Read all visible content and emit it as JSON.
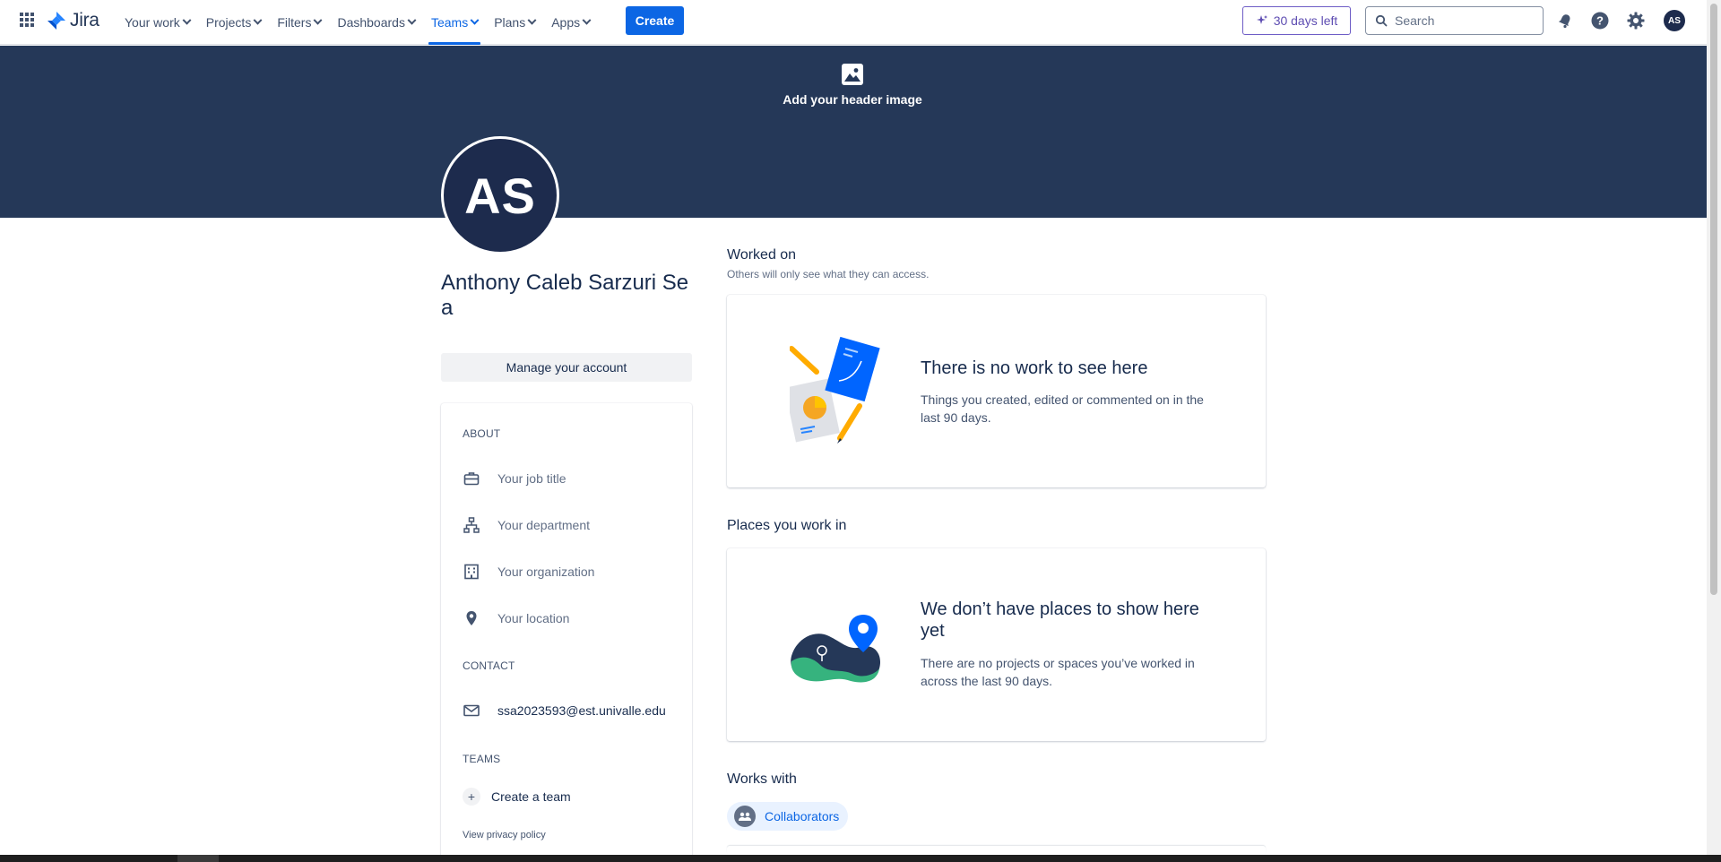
{
  "topnav": {
    "logo_text": "Jira",
    "items": [
      {
        "label": "Your work"
      },
      {
        "label": "Projects"
      },
      {
        "label": "Filters"
      },
      {
        "label": "Dashboards"
      },
      {
        "label": "Teams",
        "active": true
      },
      {
        "label": "Plans"
      },
      {
        "label": "Apps"
      }
    ],
    "create_label": "Create",
    "trial_label": "30 days left",
    "search_placeholder": "Search",
    "avatar_initials": "AS",
    "icons": [
      "apps-grid-icon",
      "jira-logo-icon",
      "sparkle-icon",
      "search-icon",
      "notifications-icon",
      "help-icon",
      "settings-icon"
    ]
  },
  "header": {
    "add_image_label": "Add your header image"
  },
  "profile": {
    "initials": "AS",
    "name": "Anthony Caleb Sarzuri Sea",
    "manage_label": "Manage your account"
  },
  "about": {
    "heading": "ABOUT",
    "job_title": "Your job title",
    "department": "Your department",
    "organization": "Your organization",
    "location": "Your location",
    "contact_heading": "CONTACT",
    "email": "ssa2023593@est.univalle.edu",
    "teams_heading": "TEAMS",
    "create_team": "Create a team",
    "privacy": "View privacy policy"
  },
  "worked_on": {
    "heading": "Worked on",
    "sub": "Others will only see what they can access.",
    "empty_title": "There is no work to see here",
    "empty_desc": "Things you created, edited or commented on in the last 90 days."
  },
  "places": {
    "heading": "Places you work in",
    "empty_title": "We don’t have places to show here yet",
    "empty_desc": "There are no projects or spaces you’ve worked in across the last 90 days."
  },
  "works_with": {
    "heading": "Works with",
    "chip_label": "Collaborators"
  },
  "colors": {
    "brand_blue": "#0c66e4",
    "header_band": "#253858",
    "avatar_bg": "#1d2b4d",
    "trial_purple": "#5e4db2"
  }
}
